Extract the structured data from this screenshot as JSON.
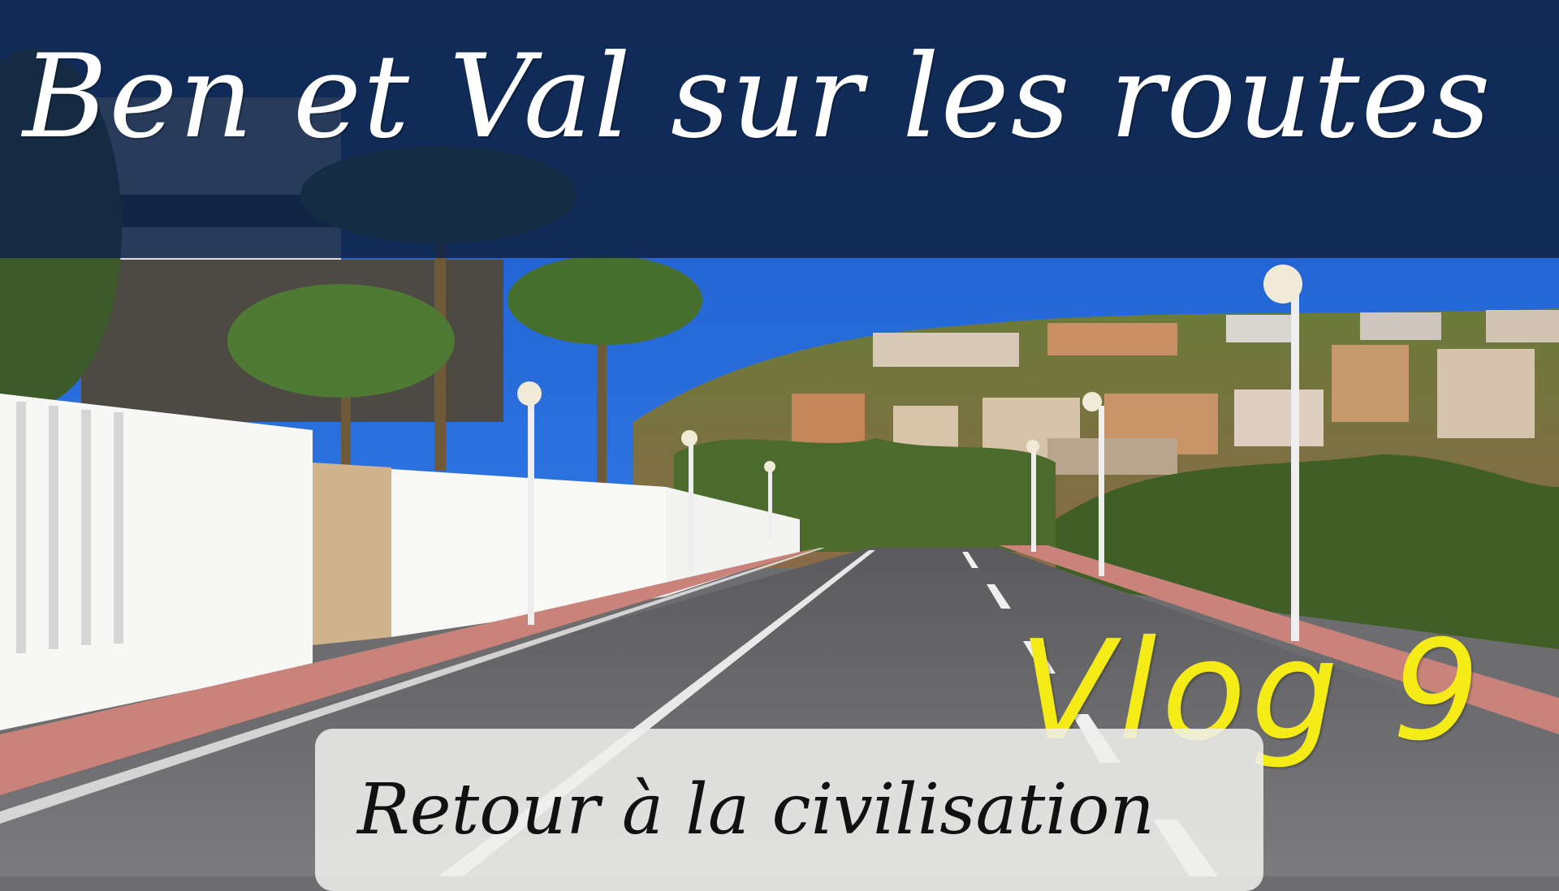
{
  "thumbnail": {
    "title": "Ben et Val sur les routes",
    "episode": "Vlog 9",
    "subtitle": "Retour à la civilisation"
  },
  "colors": {
    "sky": "#1f63d6",
    "title_banner": "#102448",
    "title_text": "#ffffff",
    "episode_text": "#f5ec17",
    "subtitle_box": "#eeeeec",
    "subtitle_text": "#111111",
    "road": "#6d6d70",
    "sidewalk": "#c9837a",
    "walls": "#f7f7f5"
  },
  "scene": {
    "description_icons": [
      "palm-tree",
      "street-lamp",
      "apartment-building",
      "road"
    ]
  }
}
